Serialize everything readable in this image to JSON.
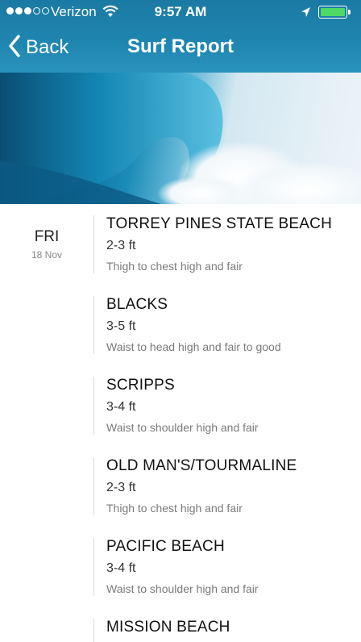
{
  "status_bar": {
    "carrier": "Verizon",
    "time": "9:57 AM",
    "signal_bars": [
      true,
      true,
      true,
      false,
      false
    ],
    "battery_color": "#4cd964"
  },
  "nav": {
    "back_label": "Back",
    "title": "Surf Report"
  },
  "colors": {
    "header": "#1f86b0"
  },
  "day": {
    "name": "FRI",
    "date": "18 Nov"
  },
  "spots": [
    {
      "name": "TORREY PINES STATE BEACH",
      "height": "2-3 ft",
      "condition": "Thigh to chest high and fair"
    },
    {
      "name": "BLACKS",
      "height": "3-5 ft",
      "condition": "Waist to head high and fair to good"
    },
    {
      "name": "SCRIPPS",
      "height": "3-4 ft",
      "condition": "Waist to shoulder high and fair"
    },
    {
      "name": "OLD MAN'S/TOURMALINE",
      "height": "2-3 ft",
      "condition": "Thigh to chest high and fair"
    },
    {
      "name": "PACIFIC BEACH",
      "height": "3-4 ft",
      "condition": "Waist to shoulder high and fair"
    },
    {
      "name": "MISSION BEACH",
      "height": "",
      "condition": ""
    }
  ]
}
